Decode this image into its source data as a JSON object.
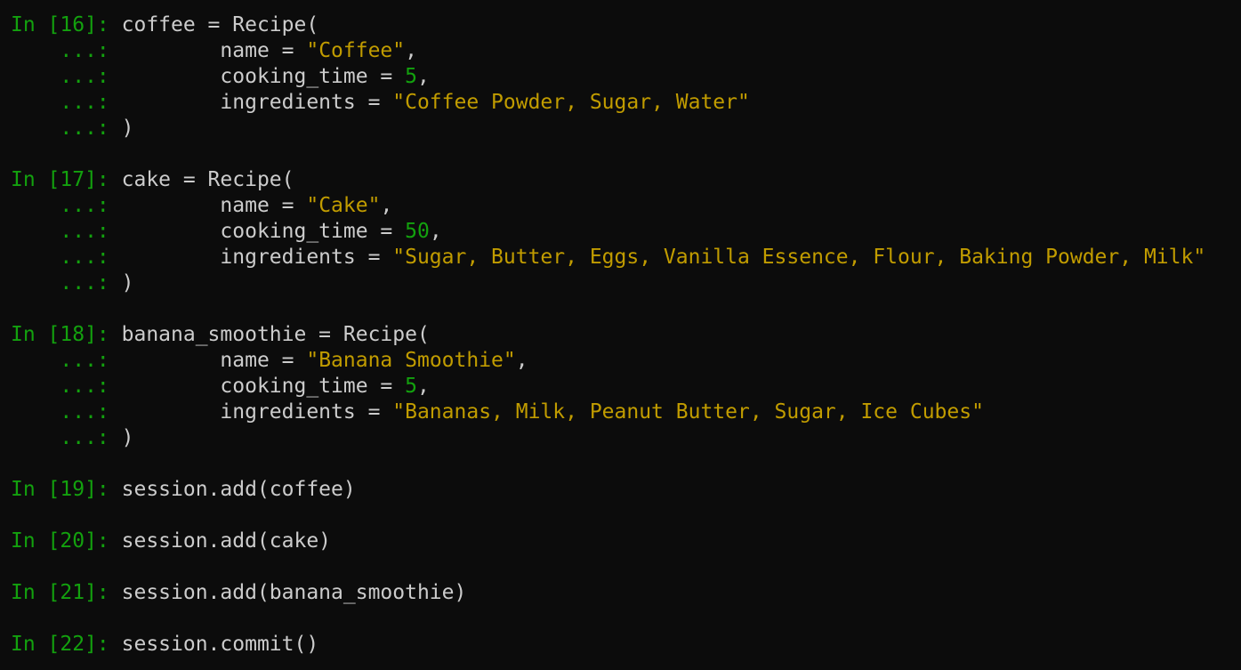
{
  "window": {
    "background": "#0c0c0c"
  },
  "colors": {
    "prompt": "#13a10e",
    "text": "#cccccc",
    "string": "#c19c00",
    "number": "#13a10e"
  },
  "lines": [
    {
      "kind": "line",
      "tokens": [
        {
          "t": "prompt",
          "v": "In [16]: "
        },
        {
          "t": "plain",
          "v": "coffee = Recipe("
        }
      ]
    },
    {
      "kind": "line",
      "tokens": [
        {
          "t": "cont",
          "v": "    ...: "
        },
        {
          "t": "plain",
          "v": "        name = "
        },
        {
          "t": "string",
          "v": "\"Coffee\""
        },
        {
          "t": "plain",
          "v": ","
        }
      ]
    },
    {
      "kind": "line",
      "tokens": [
        {
          "t": "cont",
          "v": "    ...: "
        },
        {
          "t": "plain",
          "v": "        cooking_time = "
        },
        {
          "t": "number",
          "v": "5"
        },
        {
          "t": "plain",
          "v": ","
        }
      ]
    },
    {
      "kind": "line",
      "tokens": [
        {
          "t": "cont",
          "v": "    ...: "
        },
        {
          "t": "plain",
          "v": "        ingredients = "
        },
        {
          "t": "string",
          "v": "\"Coffee Powder, Sugar, Water\""
        }
      ]
    },
    {
      "kind": "line",
      "tokens": [
        {
          "t": "cont",
          "v": "    ...: "
        },
        {
          "t": "plain",
          "v": ")"
        }
      ]
    },
    {
      "kind": "blank",
      "tokens": []
    },
    {
      "kind": "line",
      "tokens": [
        {
          "t": "prompt",
          "v": "In [17]: "
        },
        {
          "t": "plain",
          "v": "cake = Recipe("
        }
      ]
    },
    {
      "kind": "line",
      "tokens": [
        {
          "t": "cont",
          "v": "    ...: "
        },
        {
          "t": "plain",
          "v": "        name = "
        },
        {
          "t": "string",
          "v": "\"Cake\""
        },
        {
          "t": "plain",
          "v": ","
        }
      ]
    },
    {
      "kind": "line",
      "tokens": [
        {
          "t": "cont",
          "v": "    ...: "
        },
        {
          "t": "plain",
          "v": "        cooking_time = "
        },
        {
          "t": "number",
          "v": "50"
        },
        {
          "t": "plain",
          "v": ","
        }
      ]
    },
    {
      "kind": "line",
      "tokens": [
        {
          "t": "cont",
          "v": "    ...: "
        },
        {
          "t": "plain",
          "v": "        ingredients = "
        },
        {
          "t": "string",
          "v": "\"Sugar, Butter, Eggs, Vanilla Essence, Flour, Baking Powder, Milk\""
        }
      ]
    },
    {
      "kind": "line",
      "tokens": [
        {
          "t": "cont",
          "v": "    ...: "
        },
        {
          "t": "plain",
          "v": ")"
        }
      ]
    },
    {
      "kind": "blank",
      "tokens": []
    },
    {
      "kind": "line",
      "tokens": [
        {
          "t": "prompt",
          "v": "In [18]: "
        },
        {
          "t": "plain",
          "v": "banana_smoothie = Recipe("
        }
      ]
    },
    {
      "kind": "line",
      "tokens": [
        {
          "t": "cont",
          "v": "    ...: "
        },
        {
          "t": "plain",
          "v": "        name = "
        },
        {
          "t": "string",
          "v": "\"Banana Smoothie\""
        },
        {
          "t": "plain",
          "v": ","
        }
      ]
    },
    {
      "kind": "line",
      "tokens": [
        {
          "t": "cont",
          "v": "    ...: "
        },
        {
          "t": "plain",
          "v": "        cooking_time = "
        },
        {
          "t": "number",
          "v": "5"
        },
        {
          "t": "plain",
          "v": ","
        }
      ]
    },
    {
      "kind": "line",
      "tokens": [
        {
          "t": "cont",
          "v": "    ...: "
        },
        {
          "t": "plain",
          "v": "        ingredients = "
        },
        {
          "t": "string",
          "v": "\"Bananas, Milk, Peanut Butter, Sugar, Ice Cubes\""
        }
      ]
    },
    {
      "kind": "line",
      "tokens": [
        {
          "t": "cont",
          "v": "    ...: "
        },
        {
          "t": "plain",
          "v": ")"
        }
      ]
    },
    {
      "kind": "blank",
      "tokens": []
    },
    {
      "kind": "line",
      "tokens": [
        {
          "t": "prompt",
          "v": "In [19]: "
        },
        {
          "t": "plain",
          "v": "session.add(coffee)"
        }
      ]
    },
    {
      "kind": "blank",
      "tokens": []
    },
    {
      "kind": "line",
      "tokens": [
        {
          "t": "prompt",
          "v": "In [20]: "
        },
        {
          "t": "plain",
          "v": "session.add(cake)"
        }
      ]
    },
    {
      "kind": "blank",
      "tokens": []
    },
    {
      "kind": "line",
      "tokens": [
        {
          "t": "prompt",
          "v": "In [21]: "
        },
        {
          "t": "plain",
          "v": "session.add(banana_smoothie)"
        }
      ]
    },
    {
      "kind": "blank",
      "tokens": []
    },
    {
      "kind": "line",
      "tokens": [
        {
          "t": "prompt",
          "v": "In [22]: "
        },
        {
          "t": "plain",
          "v": "session.commit()"
        }
      ]
    }
  ]
}
